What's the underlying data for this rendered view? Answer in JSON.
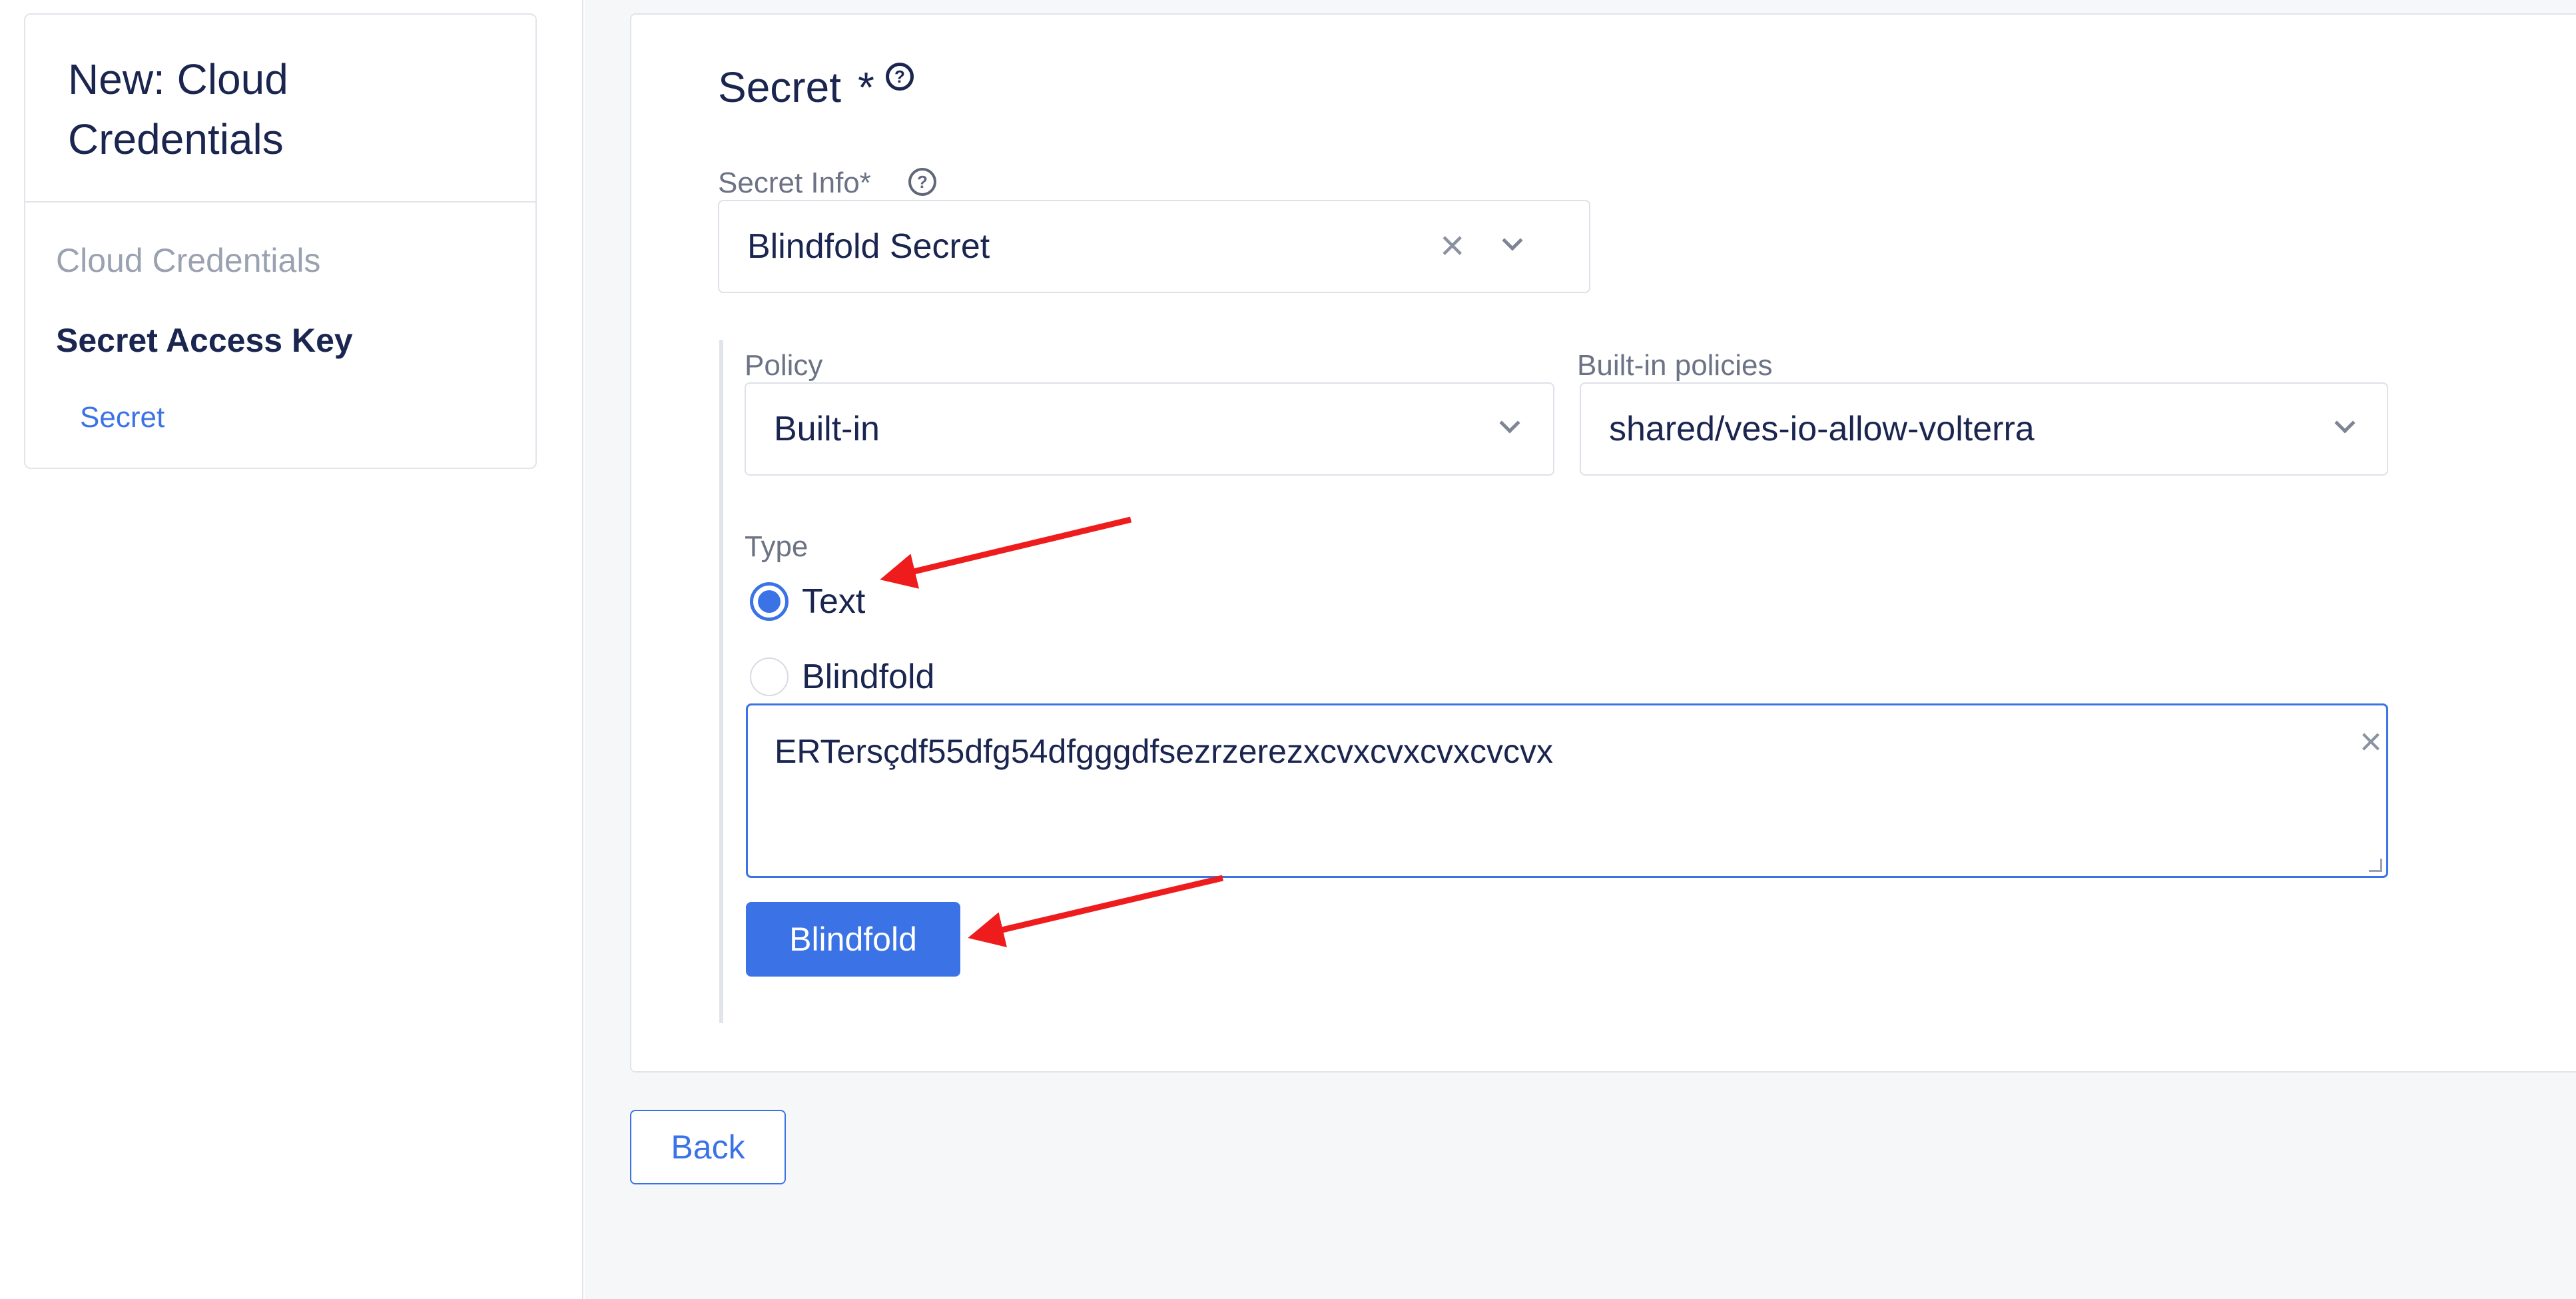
{
  "sidebar": {
    "title": "New: Cloud Credentials",
    "items": [
      {
        "label": "Cloud Credentials",
        "state": "section"
      },
      {
        "label": "Secret Access Key",
        "state": "active"
      },
      {
        "label": "Secret",
        "state": "link"
      }
    ]
  },
  "section": {
    "title": "Secret",
    "required_marker": "*",
    "help_icon": "question-circle-icon"
  },
  "secret_info": {
    "label": "Secret Info*",
    "help_icon": "question-circle-icon",
    "value": "Blindfold Secret"
  },
  "policy": {
    "label": "Policy",
    "value": "Built-in"
  },
  "builtin_policies": {
    "label": "Built-in policies",
    "value": "shared/ves-io-allow-volterra"
  },
  "type": {
    "label": "Type",
    "options": [
      {
        "label": "Text",
        "selected": true
      },
      {
        "label": "Blindfold",
        "selected": false
      }
    ]
  },
  "secret_text": {
    "value": "ERTersçdf55dfg54dfgggdfsezrzerezxcvxcvxcvxcvcvx"
  },
  "buttons": {
    "blindfold": "Blindfold",
    "back": "Back"
  },
  "colors": {
    "accent": "#3b73e6",
    "text": "#1a2550",
    "annotation_arrow": "#ee1c1c"
  }
}
